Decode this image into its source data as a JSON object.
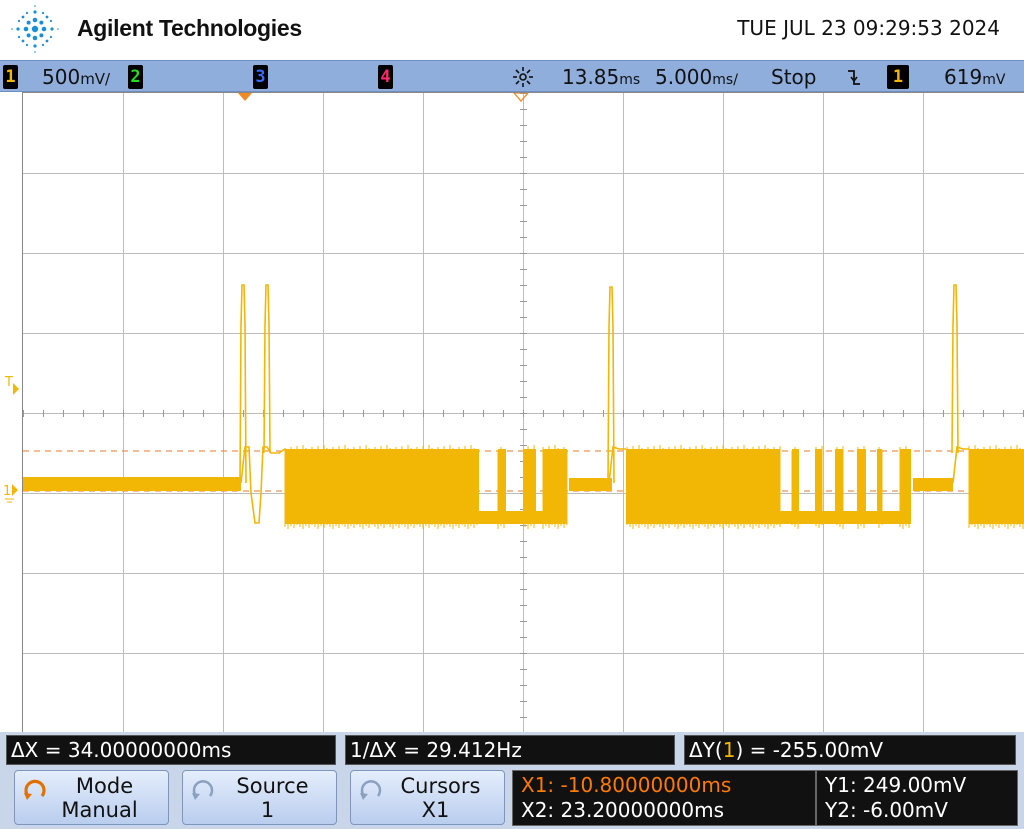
{
  "header": {
    "brand": "Agilent Technologies",
    "datetime": "TUE JUL 23 09:29:53 2024"
  },
  "status": {
    "ch1": {
      "num": "1",
      "scale": "500",
      "unit": "mV/"
    },
    "ch2": {
      "num": "2"
    },
    "ch3": {
      "num": "3"
    },
    "ch4": {
      "num": "4"
    },
    "trigger_icon": "trigger-sun-icon",
    "delay": "13.85",
    "delay_unit": "ms",
    "timebase": "5.000",
    "timebase_unit": "ms/",
    "run_state": "Stop",
    "trigger_slope_icon": "falling-edge-icon",
    "trigger_source": "1",
    "trigger_level": "619",
    "trigger_level_unit": "mV"
  },
  "markers": {
    "trigger_level": "T",
    "ch1_ground": "1"
  },
  "measurements": {
    "delta_x": "ΔX = 34.00000000ms",
    "inv_delta_x": "1/ΔX = 29.412Hz",
    "delta_y_prefix": "ΔY(",
    "delta_y_ch": "1",
    "delta_y_suffix": ") = -255.00mV"
  },
  "softkeys": {
    "mode": {
      "title": "Mode",
      "value": "Manual"
    },
    "source": {
      "title": "Source",
      "value": "1"
    },
    "cursors": {
      "title": "Cursors",
      "value": "X1"
    }
  },
  "cursor_readout": {
    "x1": "X1: -10.80000000ms",
    "x2": "X2: 23.20000000ms",
    "y1": "Y1: 249.00mV",
    "y2": "Y2: -6.00mV"
  },
  "colors": {
    "ch1": "#f2b705",
    "ch2": "#22dd22",
    "ch3": "#3a6bff",
    "ch4": "#ff2a6a",
    "cursor_x1": "#ff7a00",
    "cursor_line": "#e87a2a",
    "status_bar": "#8faedc"
  }
}
